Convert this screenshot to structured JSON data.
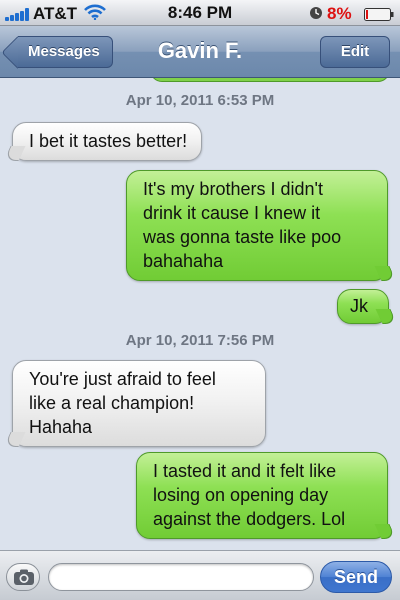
{
  "status_bar": {
    "carrier": "AT&T",
    "time": "8:46 PM",
    "battery": "8%",
    "signal_icon": "signal-bars-icon",
    "wifi_icon": "wifi-icon",
    "alarm_icon": "alarm-clock-icon",
    "battery_icon": "battery-low-icon",
    "battery_level": 0.08,
    "battery_color": "#dd1111"
  },
  "nav": {
    "back_label": "Messages",
    "title": "Gavin F.",
    "edit_label": "Edit"
  },
  "thread": {
    "timestamps": [
      "Apr 10, 2011 6:53 PM",
      "Apr 10, 2011 7:56 PM"
    ],
    "messages": [
      {
        "sender": "them",
        "text": "I bet it tastes better!"
      },
      {
        "sender": "me",
        "lines": [
          "It's my brothers I didn't",
          "drink it cause I knew it",
          "was gonna taste like poo",
          "bahahaha"
        ]
      },
      {
        "sender": "me",
        "text": "Jk"
      },
      {
        "sender": "them",
        "lines": [
          "You're just afraid to feel",
          "like a real champion!",
          "Hahaha"
        ]
      },
      {
        "sender": "me",
        "lines": [
          "I tasted it and it felt like",
          "losing on opening day",
          "against the dodgers. Lol"
        ]
      }
    ]
  },
  "composer": {
    "camera_icon": "camera-icon",
    "input_value": "",
    "send_label": "Send"
  },
  "colors": {
    "incoming_bubble": "#e8e8e8",
    "outgoing_bubble": "#8ee054",
    "send_button": "#4f82d4",
    "nav_bar": "#7590b2"
  }
}
